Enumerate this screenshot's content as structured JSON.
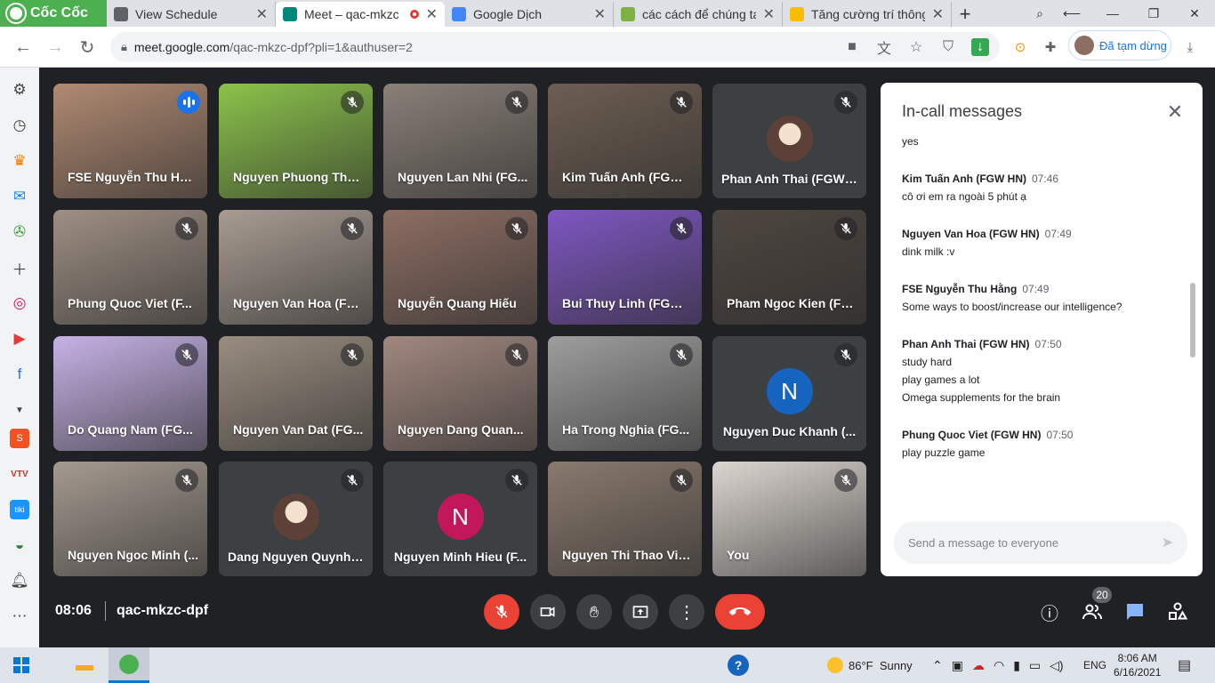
{
  "browser": {
    "brand": "Cốc Cốc",
    "tabs": [
      {
        "label": "View Schedule",
        "icon": "settings-tab-icon",
        "color": "#5f6368",
        "active": false,
        "recording": false
      },
      {
        "label": "Meet – qac-mkzc",
        "icon": "meet-icon",
        "color": "#00897b",
        "active": true,
        "recording": true
      },
      {
        "label": "Google Dịch",
        "icon": "translate-icon",
        "color": "#4285f4",
        "active": false,
        "recording": false
      },
      {
        "label": "các cách để chúng ta",
        "icon": "leaf-icon",
        "color": "#7cb342",
        "active": false,
        "recording": false
      },
      {
        "label": "Tăng cường trí thông",
        "icon": "bolt-icon",
        "color": "#fbbc04",
        "active": false,
        "recording": false
      }
    ],
    "url_host": "meet.google.com",
    "url_path": "/qac-mkzc-dpf?pli=1&authuser=2",
    "profile_label": "Đã tạm dừng"
  },
  "meeting": {
    "time": "08:06",
    "code": "qac-mkzc-dpf",
    "participant_count": "20",
    "tiles": [
      {
        "name": "FSE Nguyễn Thu Hằng",
        "speaking": true,
        "bg": "#b08a72",
        "avatar": ""
      },
      {
        "name": "Nguyen Phuong Tha...",
        "speaking": false,
        "bg": "#8bc34a",
        "avatar": ""
      },
      {
        "name": "Nguyen Lan Nhi (FG...",
        "speaking": false,
        "bg": "#8a8078",
        "avatar": ""
      },
      {
        "name": "Kim Tuấn Anh (FGW ...",
        "speaking": false,
        "bg": "#6d5e52",
        "avatar": ""
      },
      {
        "name": "Phan Anh Thai (FGW ...",
        "speaking": false,
        "bg": "#3c4043",
        "avatar": "photo"
      },
      {
        "name": "Phung Quoc Viet (F...",
        "speaking": false,
        "bg": "#9e8f84",
        "avatar": ""
      },
      {
        "name": "Nguyen Van Hoa (FG...",
        "speaking": false,
        "bg": "#a89c92",
        "avatar": ""
      },
      {
        "name": "Nguyễn Quang Hiếu",
        "speaking": false,
        "bg": "#8d6e63",
        "avatar": ""
      },
      {
        "name": "Bui Thuy Linh (FGW ...",
        "speaking": false,
        "bg": "#7e57c2",
        "avatar": ""
      },
      {
        "name": "Pham Ngoc Kien (FG...",
        "speaking": false,
        "bg": "#4e4640",
        "avatar": ""
      },
      {
        "name": "Do Quang Nam (FG...",
        "speaking": false,
        "bg": "#c7b2e6",
        "avatar": ""
      },
      {
        "name": "Nguyen Van Dat (FG...",
        "speaking": false,
        "bg": "#9a8d80",
        "avatar": ""
      },
      {
        "name": "Nguyen Dang Quan...",
        "speaking": false,
        "bg": "#a1887f",
        "avatar": ""
      },
      {
        "name": "Ha Trong Nghia (FG...",
        "speaking": false,
        "bg": "#9e9e9e",
        "avatar": ""
      },
      {
        "name": "Nguyen Duc Khanh (...",
        "speaking": false,
        "bg": "#3c4043",
        "avatar": "N",
        "avatar_color": "#1565c0"
      },
      {
        "name": "Nguyen Ngoc Minh (...",
        "speaking": false,
        "bg": "#a59a90",
        "avatar": ""
      },
      {
        "name": "Dang Nguyen Quynh ...",
        "speaking": false,
        "bg": "#3c4043",
        "avatar": "photo"
      },
      {
        "name": "Nguyen Minh Hieu (F...",
        "speaking": false,
        "bg": "#3c4043",
        "avatar": "N",
        "avatar_color": "#c2185b"
      },
      {
        "name": "Nguyen Thi Thao Vi (...",
        "speaking": false,
        "bg": "#8a7a6e",
        "avatar": ""
      },
      {
        "name": "You",
        "speaking": false,
        "bg": "#dcd6d0",
        "avatar": ""
      }
    ]
  },
  "chat": {
    "title": "In-call messages",
    "messages": [
      {
        "sender": "",
        "time": "",
        "lines": [
          "yes"
        ]
      },
      {
        "sender": "Kim Tuấn Anh (FGW HN)",
        "time": "07:46",
        "lines": [
          "cô ơi em ra ngoài 5 phút ạ"
        ]
      },
      {
        "sender": "Nguyen Van Hoa (FGW HN)",
        "time": "07:49",
        "lines": [
          "dink milk :v"
        ]
      },
      {
        "sender": "FSE Nguyễn Thu Hằng",
        "time": "07:49",
        "lines": [
          "Some ways to boost/increase our intelligence?"
        ]
      },
      {
        "sender": "Phan Anh Thai (FGW HN)",
        "time": "07:50",
        "lines": [
          "study hard",
          "play games a lot",
          "Omega supplements for the brain"
        ]
      },
      {
        "sender": "Phung Quoc Viet (FGW HN)",
        "time": "07:50",
        "lines": [
          "play puzzle game"
        ]
      }
    ],
    "input_placeholder": "Send a message to everyone"
  },
  "taskbar": {
    "weather": "86°F  Sunny",
    "lang": "ENG",
    "time": "8:06 AM",
    "date": "6/16/2021"
  }
}
